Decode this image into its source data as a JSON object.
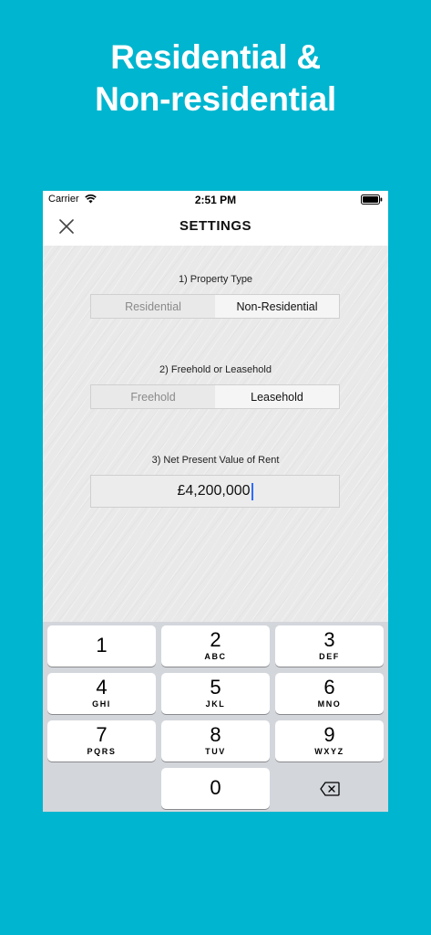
{
  "headline": {
    "line1": "Residential &",
    "line2": "Non-residential"
  },
  "status_bar": {
    "carrier": "Carrier",
    "time": "2:51 PM"
  },
  "nav": {
    "title": "SETTINGS",
    "close_icon": "close-icon"
  },
  "form": {
    "property_type": {
      "label": "1) Property Type",
      "options": [
        "Residential",
        "Non-Residential"
      ],
      "selected": "Non-Residential"
    },
    "tenure": {
      "label": "2) Freehold or Leasehold",
      "options": [
        "Freehold",
        "Leasehold"
      ],
      "selected": "Leasehold"
    },
    "rent": {
      "label": "3) Net Present Value of Rent",
      "value": "£4,200,000"
    }
  },
  "keypad": {
    "keys": [
      {
        "num": "1",
        "letters": ""
      },
      {
        "num": "2",
        "letters": "ABC"
      },
      {
        "num": "3",
        "letters": "DEF"
      },
      {
        "num": "4",
        "letters": "GHI"
      },
      {
        "num": "5",
        "letters": "JKL"
      },
      {
        "num": "6",
        "letters": "MNO"
      },
      {
        "num": "7",
        "letters": "PQRS"
      },
      {
        "num": "8",
        "letters": "TUV"
      },
      {
        "num": "9",
        "letters": "WXYZ"
      },
      {
        "num": "0",
        "letters": ""
      }
    ],
    "delete_icon": "backspace-icon"
  },
  "colors": {
    "background": "#00b5cf",
    "caret": "#2f6bff",
    "keyboard": "#d3d6db"
  }
}
